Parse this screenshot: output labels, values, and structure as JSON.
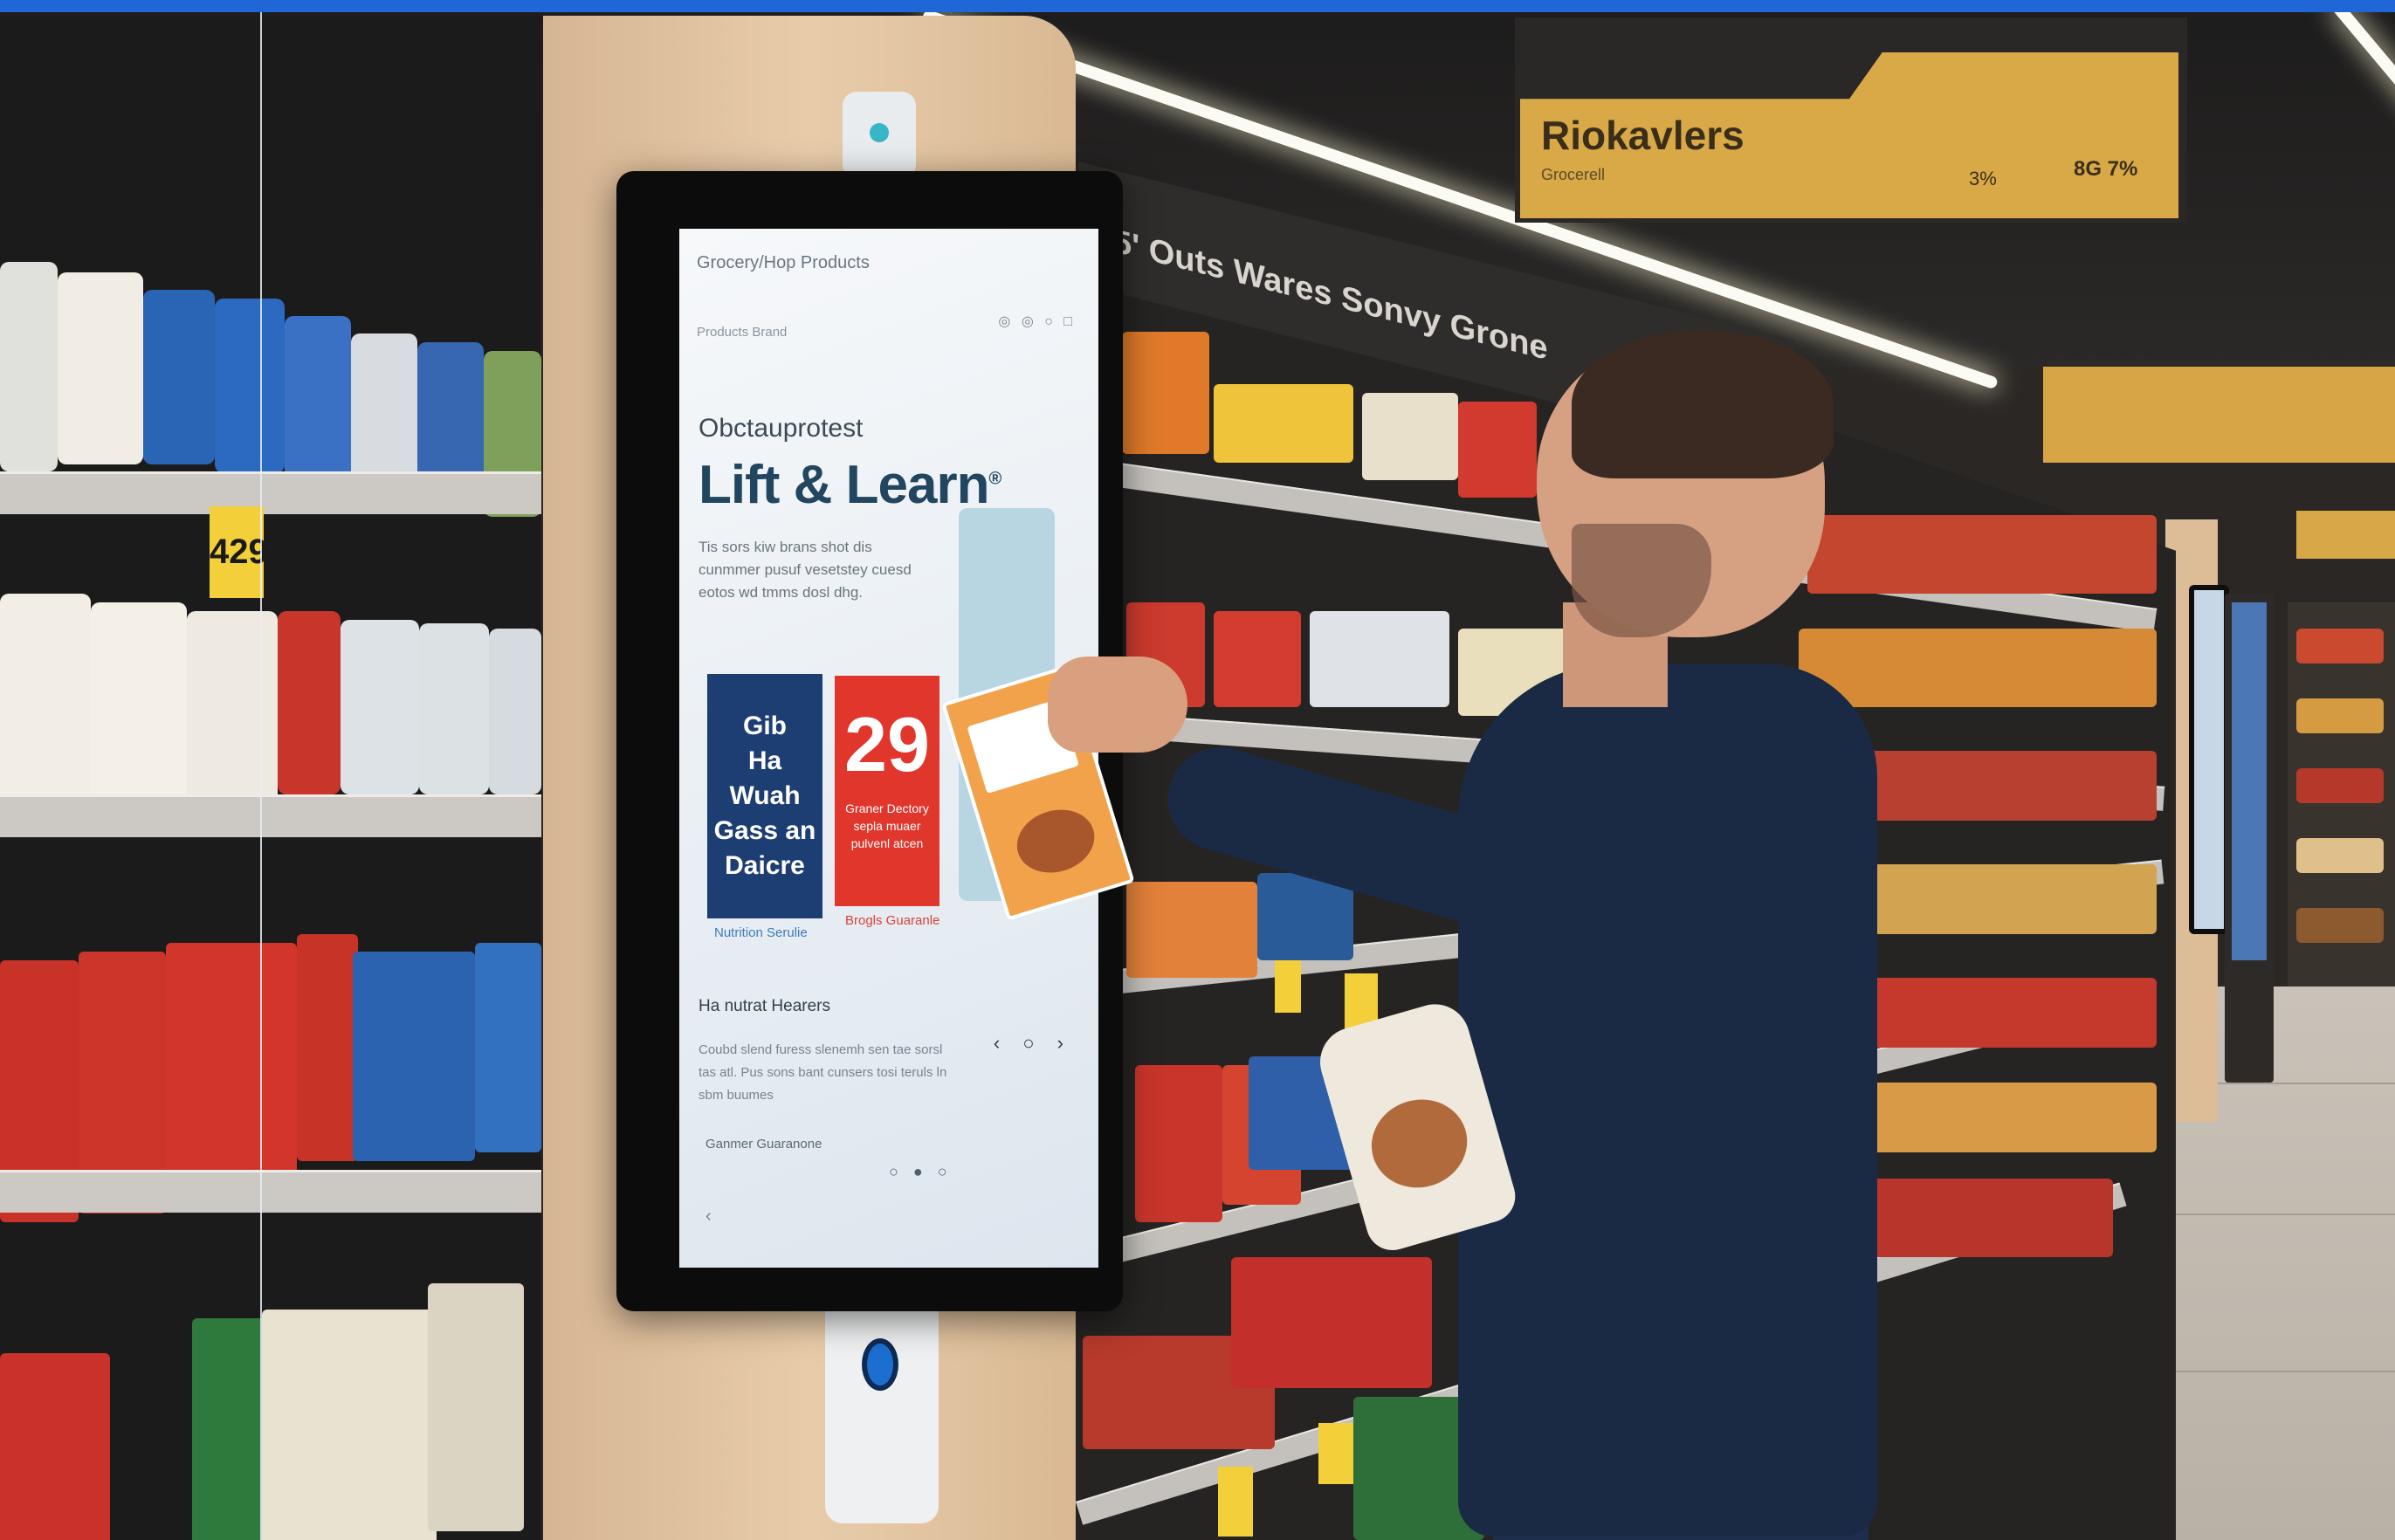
{
  "scene": {
    "description_tags": [
      "supermarket-aisle",
      "smart-shelf-kiosk",
      "shopper"
    ]
  },
  "overhead_sign": {
    "title": "Riokavlers",
    "subtitle": "Grocerell",
    "num1": "3%",
    "num2": "8G 7%"
  },
  "aisle_sign": {
    "text": "5' Outs Wares Sonvy Grone"
  },
  "price_tags": {
    "left_tag": "429"
  },
  "kiosk_screen": {
    "header": "Grocery/Hop Products",
    "nav": "Products   Brand",
    "icons": "◎ ◎ ○ □",
    "brand": "Obctauprotest",
    "title": "Lift & Learn",
    "title_mark": "®",
    "body": "Tis sors kiw brans shot dis cunmmer pusuf vesetstey cuesd eotos wd tmms dosl dhg.",
    "tile_blue": {
      "lines": [
        "Gib",
        "Ha",
        "Wuah",
        "Gass an",
        "Daicre"
      ]
    },
    "tile_red": {
      "number": "29",
      "caption": "Graner Dectory sepla muaer pulvenl atcen"
    },
    "caption_blue": "Nutrition Serulie",
    "caption_red": "Brogls Guaranle",
    "section_title": "Ha nutrat Hearers",
    "section_body": "Coubd slend furess slenemh sen tae sorsl tas atl. Pus sons bant cunsers tosi teruls ln sbm buumes",
    "arrows": "‹ ○ ›",
    "footer": "Ganmer Guaranone",
    "dots": "○ ● ○",
    "back": "‹"
  },
  "colors": {
    "top_bar": "#1f66d6",
    "screen_title": "#22465f",
    "tile_blue": "#1d3e73",
    "tile_red": "#e0362c",
    "sign_gold": "#d9a948",
    "shirt": "#1b2a44"
  }
}
